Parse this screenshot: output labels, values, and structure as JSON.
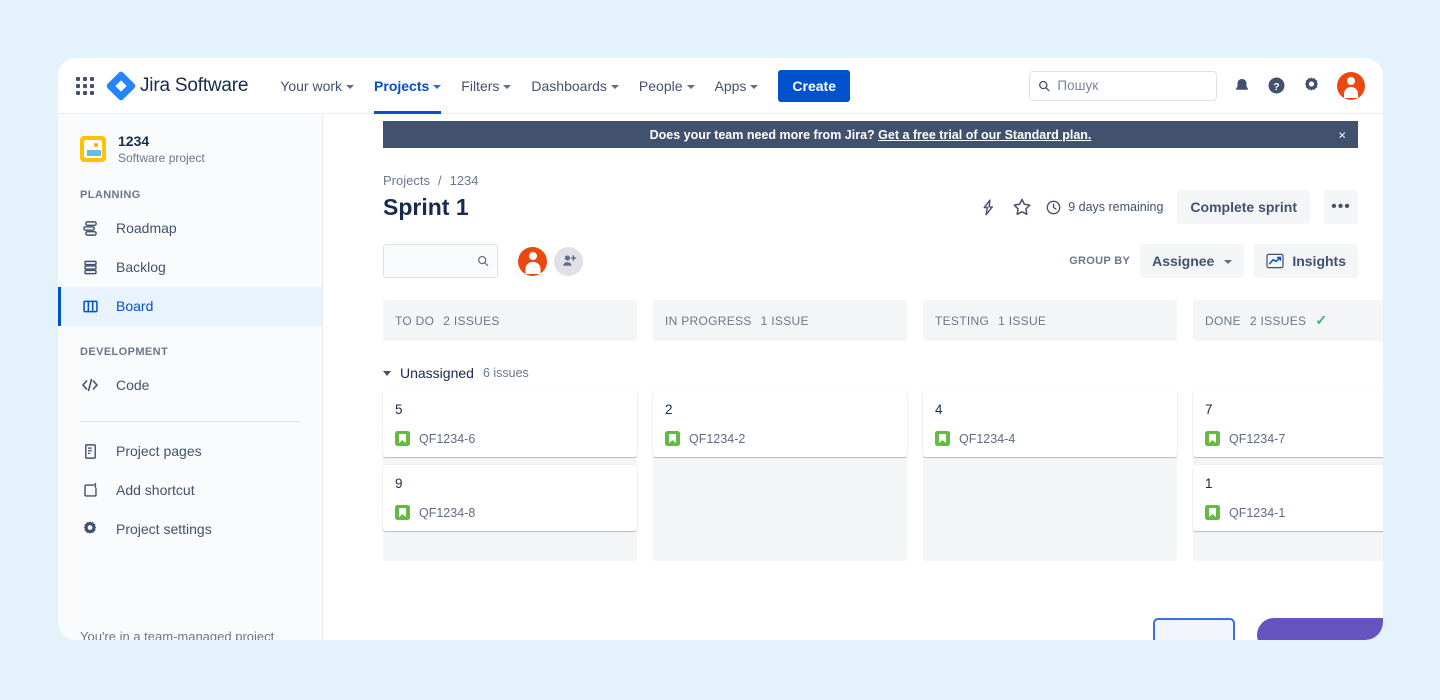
{
  "topnav": {
    "apps_icon": "apps-grid-icon",
    "brand": "Jira Software",
    "items": [
      {
        "label": "Your work",
        "has_caret": true,
        "active": false
      },
      {
        "label": "Projects",
        "has_caret": true,
        "active": true
      },
      {
        "label": "Filters",
        "has_caret": true,
        "active": false
      },
      {
        "label": "Dashboards",
        "has_caret": true,
        "active": false
      },
      {
        "label": "People",
        "has_caret": true,
        "active": false
      },
      {
        "label": "Apps",
        "has_caret": true,
        "active": false
      }
    ],
    "create_label": "Create",
    "search": {
      "placeholder": "Пошук",
      "value": "",
      "icon": "search-icon"
    },
    "right_icons": [
      "notifications-bell-icon",
      "help-question-icon",
      "settings-gear-icon"
    ],
    "avatar": {
      "name": "user-avatar",
      "color": "#e9480e"
    }
  },
  "banner": {
    "text": "Does your team need more from Jira?",
    "link": "Get a free trial of our Standard plan.",
    "close": "×",
    "bg": "#42526e"
  },
  "sidebar": {
    "project": {
      "name": "1234",
      "type": "Software project",
      "avatar_color": "#ffc400"
    },
    "sections": [
      {
        "label": "PLANNING",
        "items": [
          {
            "label": "Roadmap",
            "icon": "roadmap-icon",
            "active": false
          },
          {
            "label": "Backlog",
            "icon": "backlog-icon",
            "active": false
          },
          {
            "label": "Board",
            "icon": "board-icon",
            "active": true
          }
        ]
      },
      {
        "label": "DEVELOPMENT",
        "items": [
          {
            "label": "Code",
            "icon": "code-icon",
            "active": false
          }
        ]
      }
    ],
    "footer_items": [
      {
        "label": "Project pages",
        "icon": "pages-icon"
      },
      {
        "label": "Add shortcut",
        "icon": "add-shortcut-icon"
      },
      {
        "label": "Project settings",
        "icon": "settings-gear-icon"
      }
    ],
    "footnote": "You're in a team-managed project"
  },
  "main": {
    "breadcrumb": {
      "parent": "Projects",
      "separator": "/",
      "current": "1234"
    },
    "title": "Sprint 1",
    "title_actions": {
      "lightning_icon": "lightning-bolt-icon",
      "star_icon": "star-icon",
      "clock_icon": "clock-icon",
      "days_remaining": "9 days remaining",
      "complete_sprint": "Complete sprint",
      "more": "•••"
    },
    "filters": {
      "search_placeholder": "",
      "search_value": "",
      "search_icon": "search-icon",
      "avatar_color": "#e9480e",
      "add_people_icon": "add-people-icon",
      "group_by_label": "GROUP BY",
      "group_by_value": "Assignee",
      "insights_label": "Insights",
      "insights_icon": "insights-chart-icon"
    },
    "board": {
      "columns": [
        {
          "name": "TO DO",
          "count_text": "2 ISSUES",
          "done": false
        },
        {
          "name": "IN PROGRESS",
          "count_text": "1 ISSUE",
          "done": false
        },
        {
          "name": "TESTING",
          "count_text": "1 ISSUE",
          "done": false
        },
        {
          "name": "DONE",
          "count_text": "2 ISSUES",
          "done": true
        }
      ],
      "swimlane": {
        "name": "Unassigned",
        "count": "6 issues"
      },
      "cards": [
        [
          {
            "title": "5",
            "key": "QF1234-6",
            "type_icon": "story-icon"
          },
          {
            "title": "9",
            "key": "QF1234-8",
            "type_icon": "story-icon"
          }
        ],
        [
          {
            "title": "2",
            "key": "QF1234-2",
            "type_icon": "story-icon"
          }
        ],
        [
          {
            "title": "4",
            "key": "QF1234-4",
            "type_icon": "story-icon"
          }
        ],
        [
          {
            "title": "7",
            "key": "QF1234-7",
            "type_icon": "story-icon"
          },
          {
            "title": "1",
            "key": "QF1234-1",
            "type_icon": "story-icon"
          }
        ]
      ]
    }
  },
  "colors": {
    "page_bg": "#e4f2fb",
    "brand_blue": "#0052cc",
    "create_blue": "#0052cc",
    "banner_bg": "#42526e",
    "active_nav_bg": "#e9f2ff",
    "story_green": "#65ba43",
    "done_check": "#36b37e",
    "avatar_red": "#e9480e",
    "project_yellow": "#ffc400"
  }
}
